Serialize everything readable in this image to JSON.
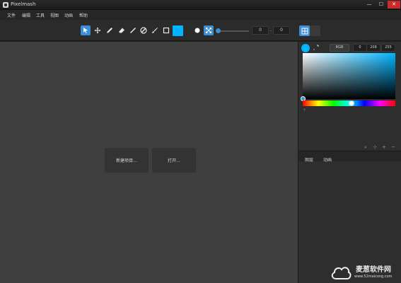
{
  "window": {
    "title": "Pixelmash",
    "minimize": "—",
    "maximize": "☐",
    "close": "✕"
  },
  "menu": [
    "文件",
    "编辑",
    "工具",
    "视图",
    "动画",
    "帮助"
  ],
  "toolbar": {
    "tools": [
      "select-tool",
      "move-tool",
      "pencil-tool",
      "eraser-tool",
      "line-tool",
      "fill-tool",
      "brush-tool",
      "rectangle-tool"
    ],
    "color": "#00b4ff",
    "size_value_1": "0",
    "size_value_2": "0",
    "grid_buttons": [
      "grid-view",
      "single-view"
    ]
  },
  "canvas": {
    "new_project": "新建项目...",
    "open": "打开..."
  },
  "color_panel": {
    "mode": "RGB",
    "r": "0",
    "g": "208",
    "b": "255",
    "current": "#00b4ff"
  },
  "layers_panel": {
    "tabs": [
      "图层",
      "动画"
    ]
  },
  "watermark": {
    "brand": "麦葱软件网",
    "url": "www.52maicong.com"
  }
}
